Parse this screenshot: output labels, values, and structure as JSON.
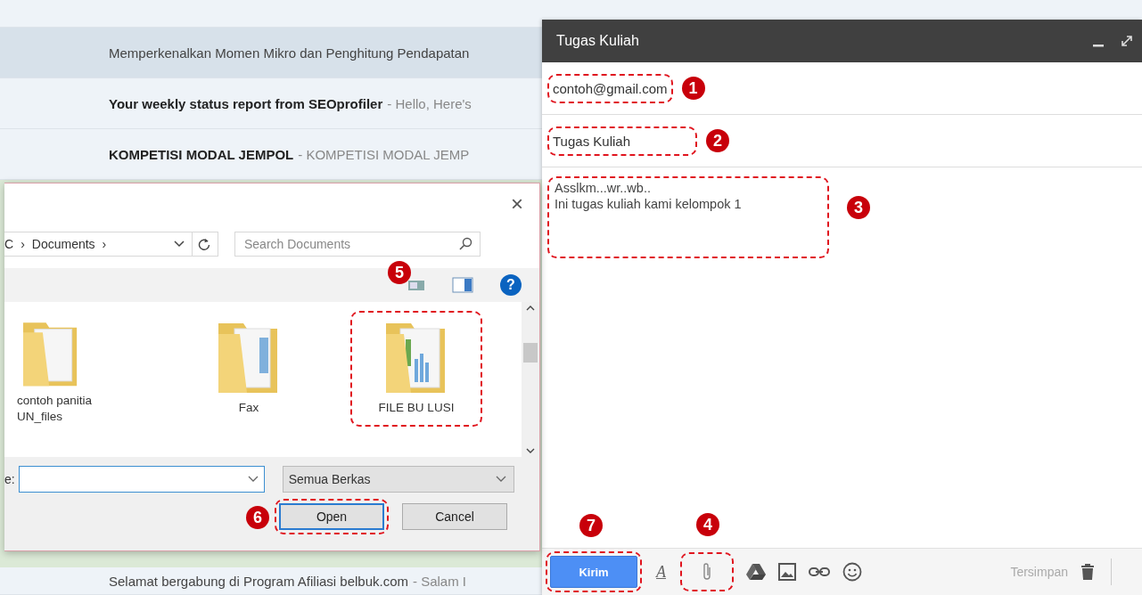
{
  "email_list": {
    "rows": [
      {
        "subject": "Memperkenalkan Momen Mikro dan Penghitung Pendapatan",
        "unread": false,
        "highlighted": true
      },
      {
        "subject": "Your weekly status report from SEOprofiler",
        "snippet": "- Hello, Here's",
        "unread": true,
        "highlighted": false
      },
      {
        "subject": "KOMPETISI MODAL JEMPOL",
        "snippet": "- KOMPETISI MODAL JEMP",
        "unread": true,
        "highlighted": false
      },
      {
        "subject": "Selamat bergabung di Program Afiliasi belbuk.com",
        "snippet": "- Salam I",
        "unread": false,
        "highlighted": false
      }
    ]
  },
  "file_dialog": {
    "close": "×",
    "breadcrumb": [
      {
        "label": "C",
        "separator": "›"
      },
      {
        "label": "Documents",
        "separator": "›"
      }
    ],
    "search": {
      "placeholder": "Search Documents"
    },
    "items": [
      {
        "name": "contoh panitia UN_files",
        "kind": "documents"
      },
      {
        "name": "Fax",
        "kind": "images"
      },
      {
        "name": "FILE BU LUSI",
        "kind": "charts",
        "annotation": {
          "marker": "5",
          "outlined": true
        }
      }
    ],
    "file_name_label": "e:",
    "file_type": {
      "value": "Semua Berkas"
    },
    "buttons": [
      {
        "label": "Open",
        "default": true,
        "annotation": {
          "marker": "6",
          "outlined": true
        }
      },
      {
        "label": "Cancel",
        "default": false
      }
    ],
    "help": "?"
  },
  "compose": {
    "title": "Tugas Kuliah",
    "to": {
      "value": "contoh@gmail.com",
      "annotation": {
        "marker": "1",
        "outlined": true
      }
    },
    "subject": {
      "value": "Tugas Kuliah",
      "annotation": {
        "marker": "2",
        "outlined": true
      }
    },
    "body": {
      "value": "Asslkm...wr..wb..\nIni tugas kuliah kami kelompok 1",
      "annotation": {
        "marker": "3",
        "outlined": true
      }
    },
    "send": {
      "label": "Kirim",
      "annotation": {
        "marker": "7",
        "outlined": true
      }
    },
    "format": "A",
    "attach": {
      "annotation": {
        "marker": "4",
        "outlined": true
      }
    },
    "status": "Tersimpan"
  }
}
